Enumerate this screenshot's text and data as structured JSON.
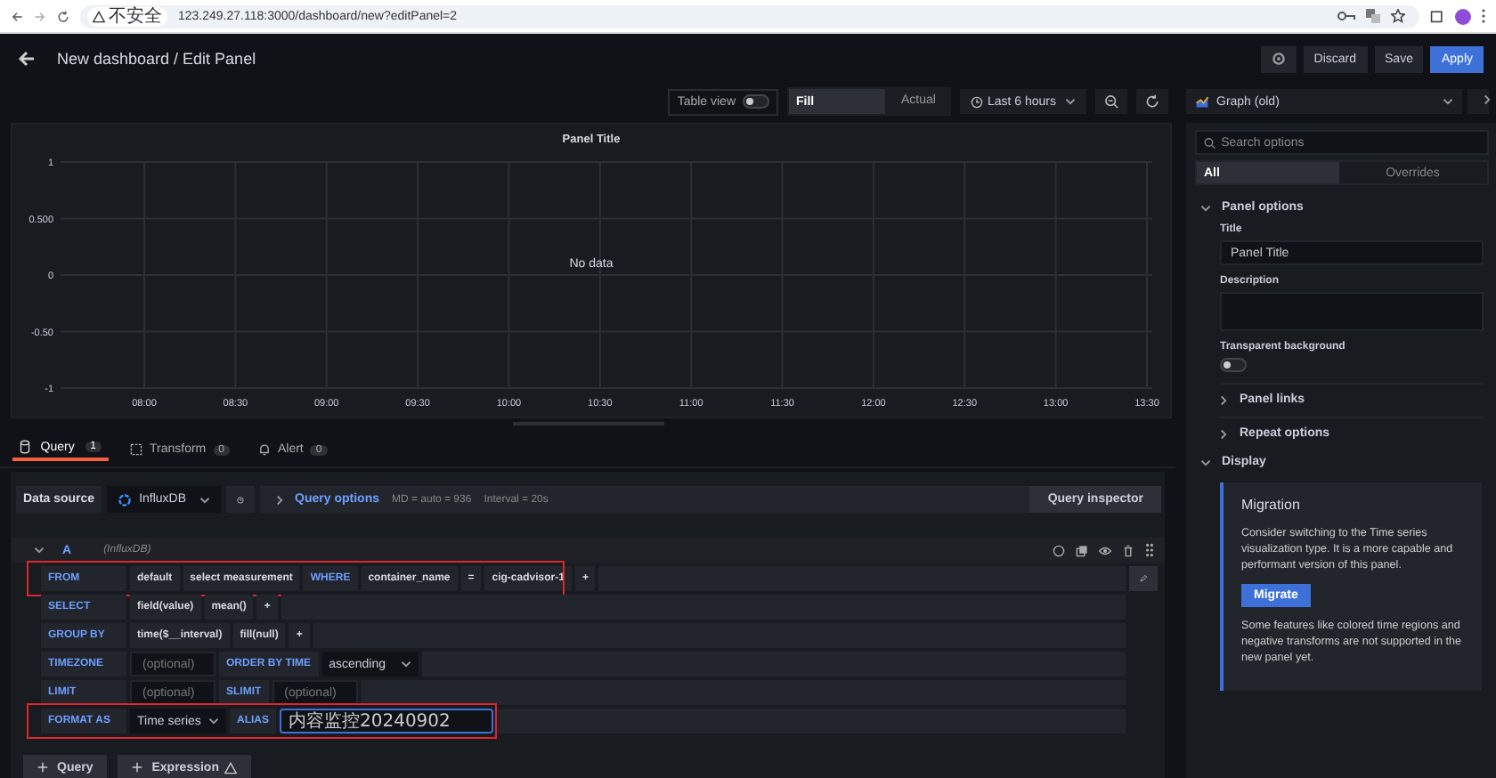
{
  "browser": {
    "security_label": "不安全",
    "url": "123.249.27.118:3000/dashboard/new?editPanel=2"
  },
  "header": {
    "title": "New dashboard / Edit Panel",
    "buttons": [
      {
        "label": "Discard",
        "kind": "secondary"
      },
      {
        "label": "Save",
        "kind": "secondary"
      },
      {
        "label": "Apply",
        "kind": "primary"
      }
    ]
  },
  "toolbar": {
    "table_view": {
      "label": "Table view",
      "on": false
    },
    "view_modes": [
      {
        "label": "Fill",
        "selected": true
      },
      {
        "label": "Actual",
        "selected": false
      }
    ],
    "time_range": "Last 6 hours",
    "visualization": "Graph (old)"
  },
  "panel": {
    "title": "Panel Title",
    "message": "No data",
    "y_ticks": [
      "1",
      "0.500",
      "0",
      "-0.50",
      "-1"
    ],
    "x_ticks": [
      "08:00",
      "08:30",
      "09:00",
      "09:30",
      "10:00",
      "10:30",
      "11:00",
      "11:30",
      "12:00",
      "12:30",
      "13:00",
      "13:30"
    ]
  },
  "query_tabs": [
    {
      "label": "Query",
      "count": "1",
      "selected": true
    },
    {
      "label": "Transform",
      "count": "0",
      "selected": false
    },
    {
      "label": "Alert",
      "count": "0",
      "selected": false
    }
  ],
  "datasource": {
    "label": "Data source",
    "name": "InfluxDB",
    "options_label": "Query options",
    "md": "MD = auto = 936",
    "interval": "Interval = 20s",
    "inspector": "Query inspector"
  },
  "query": {
    "ref": "A",
    "source": "(InfluxDB)",
    "expanded": true,
    "rows": [
      {
        "label": "FROM",
        "highlighted": true,
        "parts": [
          {
            "kind": "segment",
            "text": "default"
          },
          {
            "kind": "segment",
            "text": "select measurement"
          },
          {
            "kind": "keyword",
            "text": "WHERE"
          },
          {
            "kind": "segment",
            "text": "container_name"
          },
          {
            "kind": "segment",
            "text": "="
          },
          {
            "kind": "segment",
            "text": "cig-cadvisor-1"
          },
          {
            "kind": "segment",
            "text": "+"
          }
        ]
      },
      {
        "label": "SELECT",
        "highlighted": false,
        "parts": [
          {
            "kind": "segment",
            "text": "field(value)"
          },
          {
            "kind": "segment",
            "text": "mean()"
          },
          {
            "kind": "segment",
            "text": "+"
          }
        ]
      },
      {
        "label": "GROUP BY",
        "highlighted": false,
        "parts": [
          {
            "kind": "segment",
            "text": "time($__interval)"
          },
          {
            "kind": "segment",
            "text": "fill(null)"
          },
          {
            "kind": "segment",
            "text": "+"
          }
        ]
      },
      {
        "label": "TIMEZONE",
        "highlighted": false,
        "parts": [
          {
            "kind": "input",
            "placeholder": "(optional)"
          },
          {
            "kind": "keyword",
            "text": "ORDER BY TIME"
          },
          {
            "kind": "select",
            "text": "ascending"
          }
        ]
      },
      {
        "label": "LIMIT",
        "highlighted": false,
        "parts": [
          {
            "kind": "input",
            "placeholder": "(optional)"
          },
          {
            "kind": "keyword",
            "text": "SLIMIT"
          },
          {
            "kind": "input",
            "placeholder": "(optional)"
          }
        ]
      },
      {
        "label": "FORMAT AS",
        "highlighted": true,
        "parts": [
          {
            "kind": "select",
            "text": "Time series"
          },
          {
            "kind": "keyword",
            "text": "ALIAS"
          },
          {
            "kind": "alias",
            "value": "内容监控20240902"
          }
        ]
      }
    ]
  },
  "add_buttons": [
    {
      "label": "Query",
      "warning": false
    },
    {
      "label": "Expression",
      "warning": true
    }
  ],
  "options": {
    "search_placeholder": "Search options",
    "tabs": [
      {
        "label": "All",
        "selected": true
      },
      {
        "label": "Overrides",
        "selected": false
      }
    ],
    "panel_options": {
      "label": "Panel options",
      "expanded": true,
      "title_label": "Title",
      "title_value": "Panel Title",
      "description_label": "Description",
      "transparent_label": "Transparent background",
      "transparent_on": false
    },
    "subsections": [
      {
        "label": "Panel links",
        "expanded": false
      },
      {
        "label": "Repeat options",
        "expanded": false
      }
    ],
    "display": {
      "label": "Display",
      "expanded": true
    },
    "migration": {
      "title": "Migration",
      "text": "Consider switching to the Time series visualization type. It is a more capable and performant version of this panel.",
      "button": "Migrate",
      "note": "Some features like colored time regions and negative transforms are not supported in the new panel yet."
    }
  }
}
